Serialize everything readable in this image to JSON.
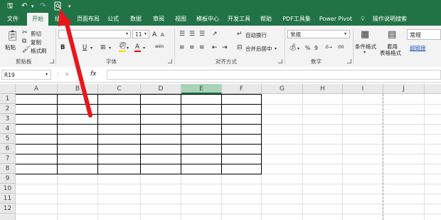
{
  "quick_access": {
    "save_icon": "save-icon",
    "undo_icon": "undo-icon",
    "redo_icon": "redo-icon",
    "preview_icon": "print-preview-icon"
  },
  "tabs": [
    {
      "label": "文件"
    },
    {
      "label": "开始"
    },
    {
      "label": "插入"
    },
    {
      "label": "页面布局"
    },
    {
      "label": "公式"
    },
    {
      "label": "数据"
    },
    {
      "label": "审阅"
    },
    {
      "label": "视图"
    },
    {
      "label": "模板中心"
    },
    {
      "label": "开发工具"
    },
    {
      "label": "帮助"
    },
    {
      "label": "PDF工具集"
    },
    {
      "label": "Power Pivot"
    },
    {
      "label": "操作说明搜索"
    }
  ],
  "ribbon": {
    "clipboard": {
      "paste": "粘贴",
      "cut": "剪切",
      "copy": "复制",
      "format_painter": "格式刷",
      "group": "剪贴板"
    },
    "font": {
      "name": "",
      "size": "11",
      "bold": "B",
      "italic": "I",
      "underline": "U",
      "group": "字体",
      "grow": "A",
      "shrink": "A",
      "wen": "wén"
    },
    "alignment": {
      "wrap": "自动换行",
      "merge": "合并后居中",
      "group": "对齐方式"
    },
    "number": {
      "format": "常规",
      "percent": "%",
      "comma": "9",
      "group": "数字"
    },
    "styles": {
      "conditional": "条件格式",
      "table_fmt_line1": "套用",
      "table_fmt_line2": "表格格式",
      "style_normal": "常规",
      "hyperlink": "超链接"
    }
  },
  "formula_bar": {
    "name_box": "R19",
    "cancel": "✕",
    "enter": "✓",
    "fx": "fx",
    "value": ""
  },
  "sheet": {
    "columns": [
      "A",
      "B",
      "C",
      "D",
      "E",
      "F",
      "G",
      "H",
      "I",
      "J"
    ],
    "rows": [
      "1",
      "2",
      "3",
      "4",
      "5",
      "6",
      "7",
      "8",
      "9",
      "10",
      "11",
      "12"
    ],
    "selected_column": "E"
  },
  "annotation": {
    "color": "#e8161b"
  },
  "colors": {
    "accent": "#217346",
    "selected_header": "#a9d3b9"
  }
}
